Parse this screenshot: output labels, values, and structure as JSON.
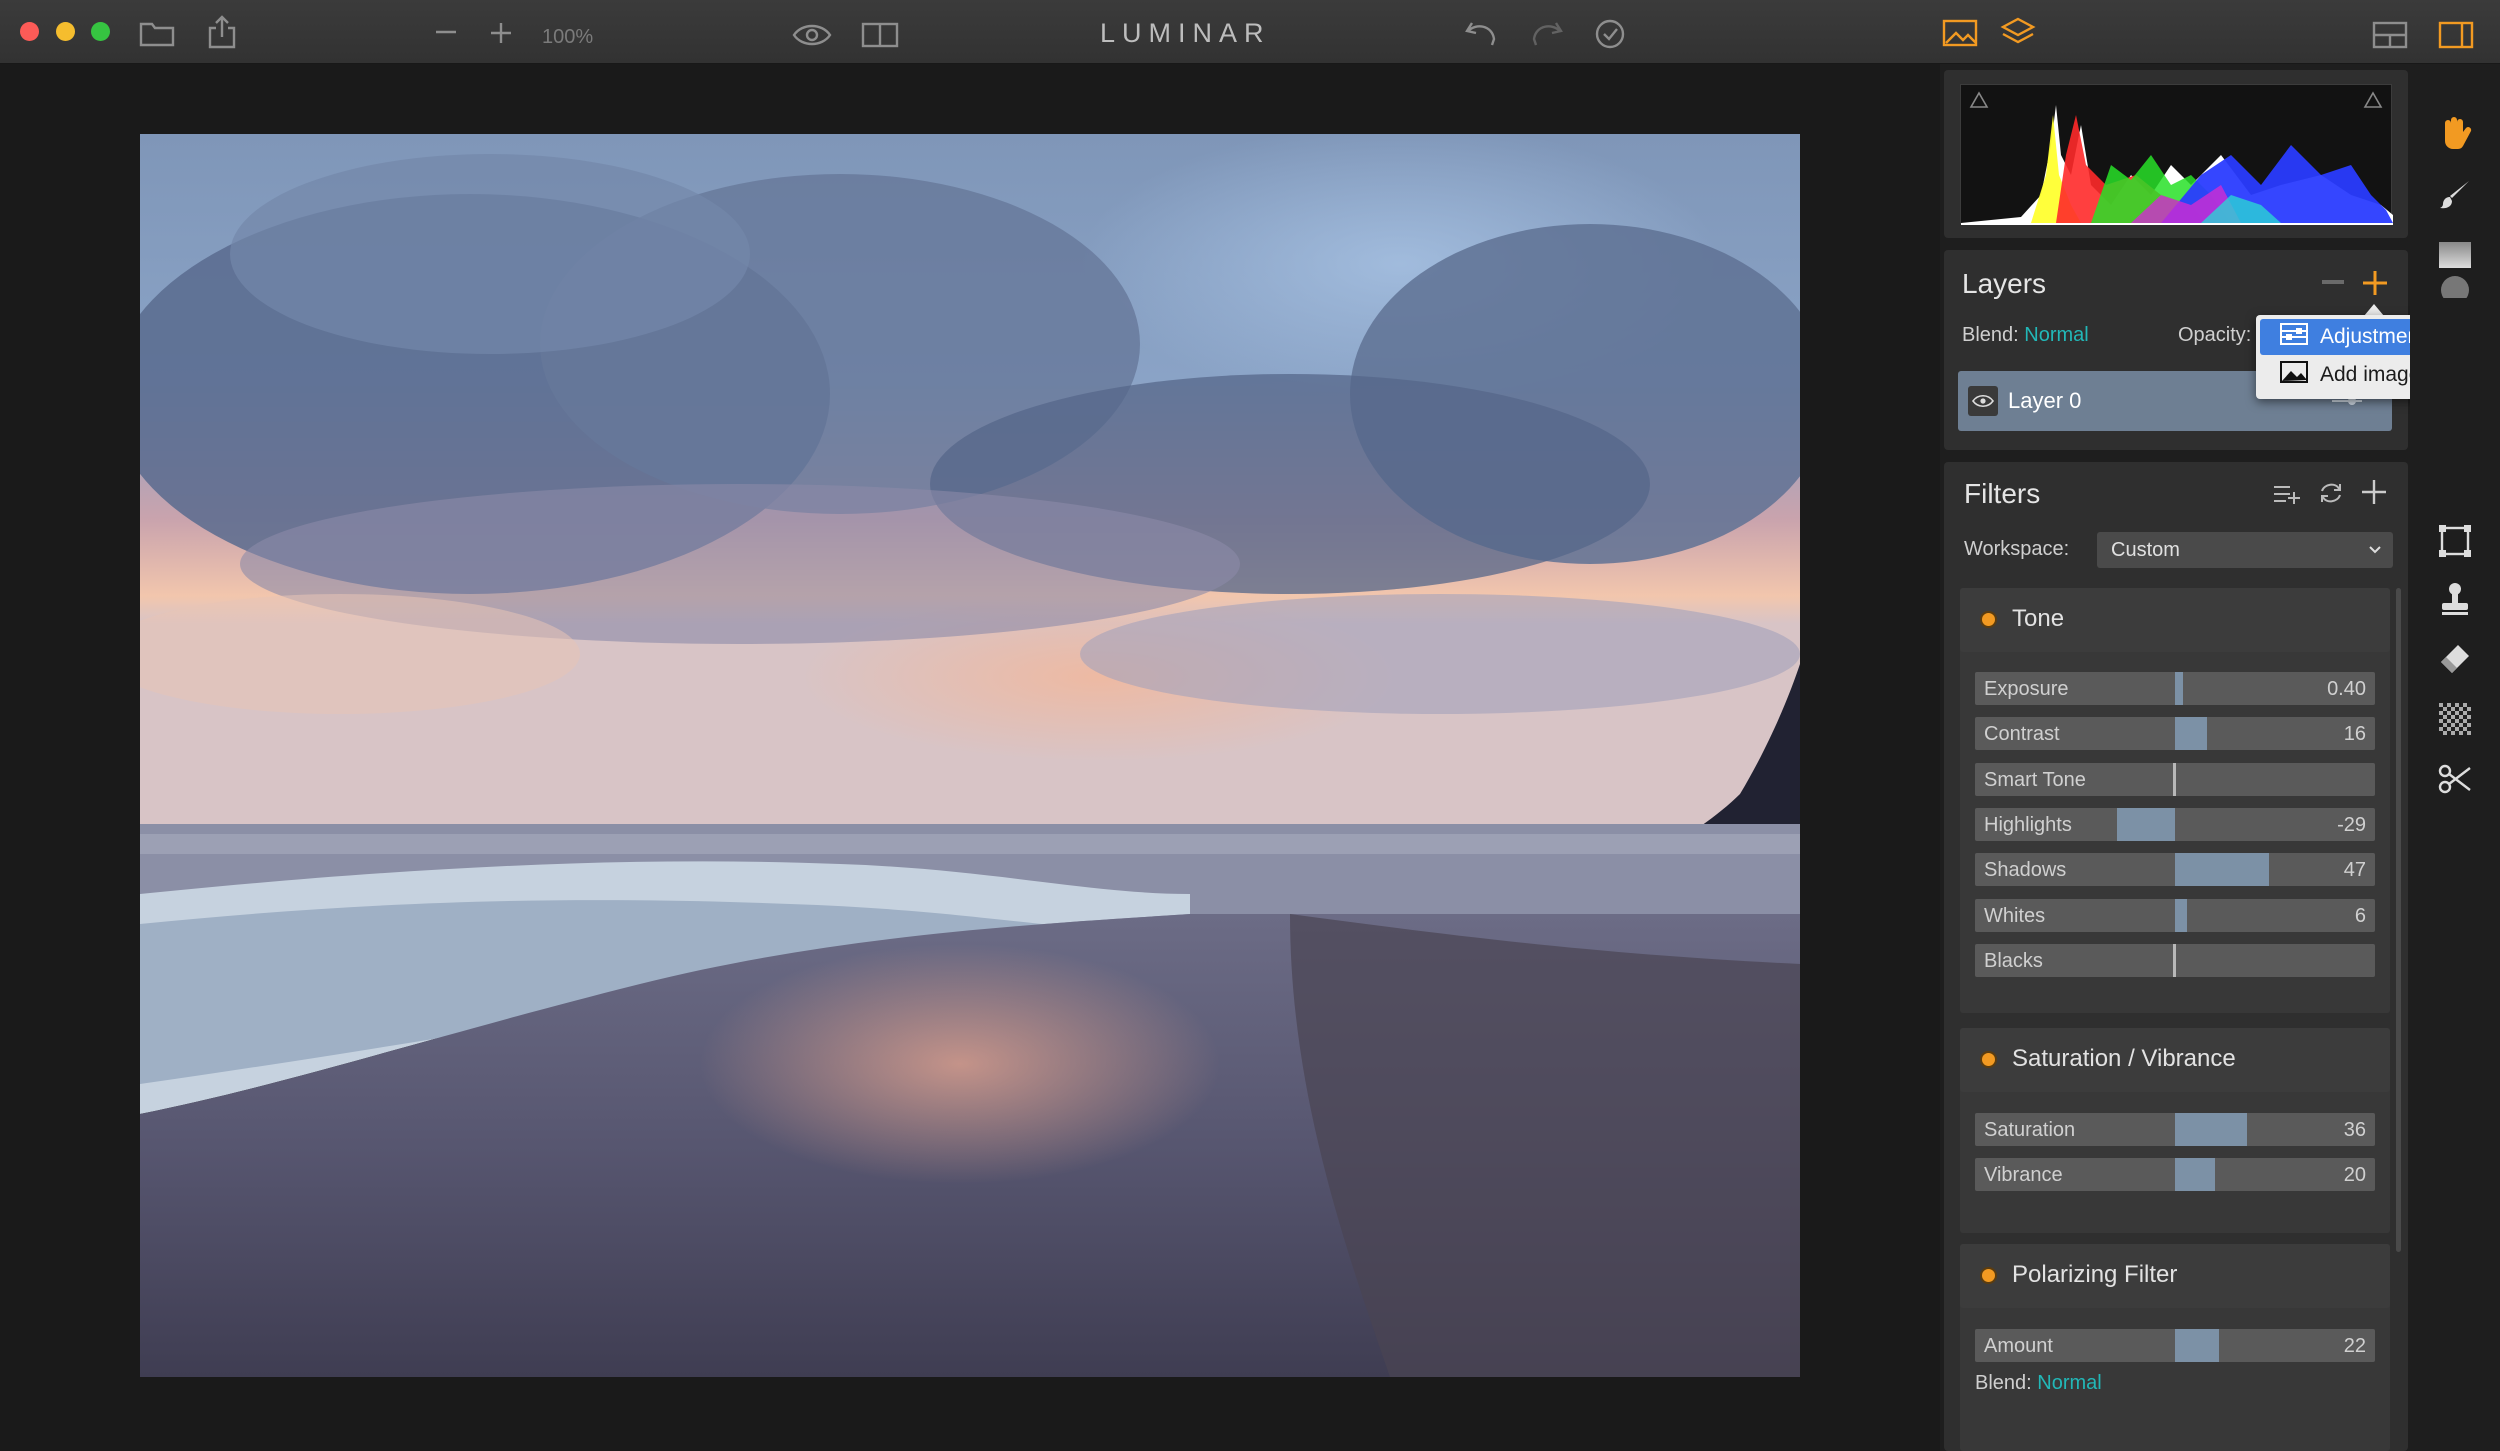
{
  "app": {
    "title": "LUMINAR",
    "zoom": "100%"
  },
  "histogram": {
    "clip_shadows_icon": "triangle-icon",
    "clip_highlights_icon": "triangle-icon"
  },
  "layers": {
    "title": "Layers",
    "blend_label": "Blend:",
    "blend_value": "Normal",
    "opacity_label": "Opacity:",
    "layer_name": "Layer 0",
    "menu": {
      "adjustment": "Adjustment",
      "add_image": "Add image..."
    }
  },
  "filters": {
    "title": "Filters",
    "workspace_label": "Workspace:",
    "workspace_value": "Custom",
    "tone": {
      "title": "Tone",
      "sliders": [
        {
          "label": "Exposure",
          "value": "0.40",
          "level": 0.04
        },
        {
          "label": "Contrast",
          "value": "16",
          "level": 0.16
        },
        {
          "label": "Smart Tone",
          "value": "",
          "level": 0
        },
        {
          "label": "Highlights",
          "value": "-29",
          "level": -0.29
        },
        {
          "label": "Shadows",
          "value": "47",
          "level": 0.47
        },
        {
          "label": "Whites",
          "value": "6",
          "level": 0.06
        },
        {
          "label": "Blacks",
          "value": "",
          "level": 0
        }
      ]
    },
    "satvib": {
      "title": "Saturation / Vibrance",
      "sliders": [
        {
          "label": "Saturation",
          "value": "36",
          "level": 0.36
        },
        {
          "label": "Vibrance",
          "value": "20",
          "level": 0.2
        }
      ]
    },
    "polarizing": {
      "title": "Polarizing Filter",
      "sliders": [
        {
          "label": "Amount",
          "value": "22",
          "level": 0.22
        }
      ],
      "blend_label": "Blend:",
      "blend_value": "Normal"
    }
  },
  "colors": {
    "accent_orange": "#f29a22",
    "teal": "#22b7b7",
    "slider_fill": "#7c91a6"
  }
}
